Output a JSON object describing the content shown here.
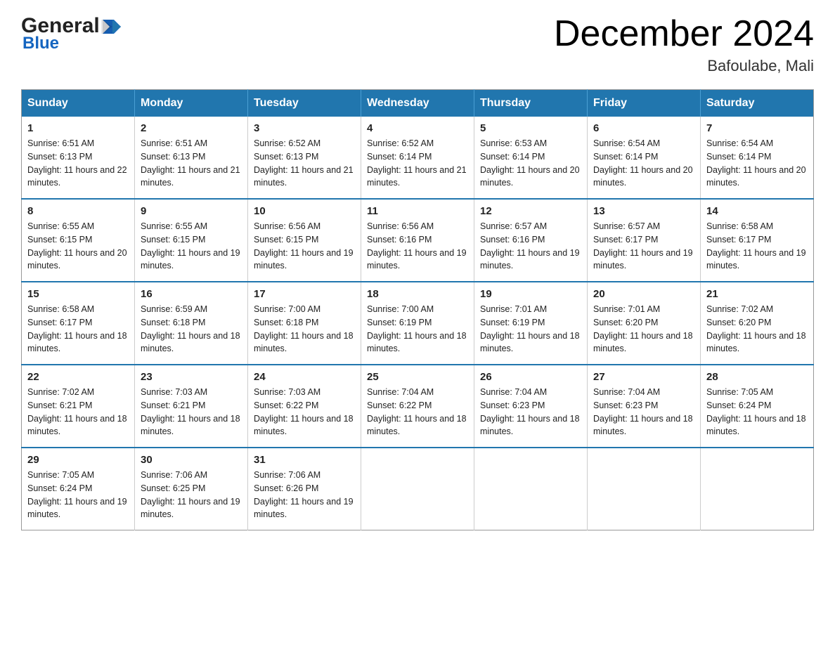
{
  "header": {
    "logo_general": "General",
    "logo_blue": "Blue",
    "title": "December 2024",
    "subtitle": "Bafoulabe, Mali"
  },
  "days_of_week": [
    "Sunday",
    "Monday",
    "Tuesday",
    "Wednesday",
    "Thursday",
    "Friday",
    "Saturday"
  ],
  "weeks": [
    [
      {
        "day": "1",
        "sunrise": "6:51 AM",
        "sunset": "6:13 PM",
        "daylight": "11 hours and 22 minutes."
      },
      {
        "day": "2",
        "sunrise": "6:51 AM",
        "sunset": "6:13 PM",
        "daylight": "11 hours and 21 minutes."
      },
      {
        "day": "3",
        "sunrise": "6:52 AM",
        "sunset": "6:13 PM",
        "daylight": "11 hours and 21 minutes."
      },
      {
        "day": "4",
        "sunrise": "6:52 AM",
        "sunset": "6:14 PM",
        "daylight": "11 hours and 21 minutes."
      },
      {
        "day": "5",
        "sunrise": "6:53 AM",
        "sunset": "6:14 PM",
        "daylight": "11 hours and 20 minutes."
      },
      {
        "day": "6",
        "sunrise": "6:54 AM",
        "sunset": "6:14 PM",
        "daylight": "11 hours and 20 minutes."
      },
      {
        "day": "7",
        "sunrise": "6:54 AM",
        "sunset": "6:14 PM",
        "daylight": "11 hours and 20 minutes."
      }
    ],
    [
      {
        "day": "8",
        "sunrise": "6:55 AM",
        "sunset": "6:15 PM",
        "daylight": "11 hours and 20 minutes."
      },
      {
        "day": "9",
        "sunrise": "6:55 AM",
        "sunset": "6:15 PM",
        "daylight": "11 hours and 19 minutes."
      },
      {
        "day": "10",
        "sunrise": "6:56 AM",
        "sunset": "6:15 PM",
        "daylight": "11 hours and 19 minutes."
      },
      {
        "day": "11",
        "sunrise": "6:56 AM",
        "sunset": "6:16 PM",
        "daylight": "11 hours and 19 minutes."
      },
      {
        "day": "12",
        "sunrise": "6:57 AM",
        "sunset": "6:16 PM",
        "daylight": "11 hours and 19 minutes."
      },
      {
        "day": "13",
        "sunrise": "6:57 AM",
        "sunset": "6:17 PM",
        "daylight": "11 hours and 19 minutes."
      },
      {
        "day": "14",
        "sunrise": "6:58 AM",
        "sunset": "6:17 PM",
        "daylight": "11 hours and 19 minutes."
      }
    ],
    [
      {
        "day": "15",
        "sunrise": "6:58 AM",
        "sunset": "6:17 PM",
        "daylight": "11 hours and 18 minutes."
      },
      {
        "day": "16",
        "sunrise": "6:59 AM",
        "sunset": "6:18 PM",
        "daylight": "11 hours and 18 minutes."
      },
      {
        "day": "17",
        "sunrise": "7:00 AM",
        "sunset": "6:18 PM",
        "daylight": "11 hours and 18 minutes."
      },
      {
        "day": "18",
        "sunrise": "7:00 AM",
        "sunset": "6:19 PM",
        "daylight": "11 hours and 18 minutes."
      },
      {
        "day": "19",
        "sunrise": "7:01 AM",
        "sunset": "6:19 PM",
        "daylight": "11 hours and 18 minutes."
      },
      {
        "day": "20",
        "sunrise": "7:01 AM",
        "sunset": "6:20 PM",
        "daylight": "11 hours and 18 minutes."
      },
      {
        "day": "21",
        "sunrise": "7:02 AM",
        "sunset": "6:20 PM",
        "daylight": "11 hours and 18 minutes."
      }
    ],
    [
      {
        "day": "22",
        "sunrise": "7:02 AM",
        "sunset": "6:21 PM",
        "daylight": "11 hours and 18 minutes."
      },
      {
        "day": "23",
        "sunrise": "7:03 AM",
        "sunset": "6:21 PM",
        "daylight": "11 hours and 18 minutes."
      },
      {
        "day": "24",
        "sunrise": "7:03 AM",
        "sunset": "6:22 PM",
        "daylight": "11 hours and 18 minutes."
      },
      {
        "day": "25",
        "sunrise": "7:04 AM",
        "sunset": "6:22 PM",
        "daylight": "11 hours and 18 minutes."
      },
      {
        "day": "26",
        "sunrise": "7:04 AM",
        "sunset": "6:23 PM",
        "daylight": "11 hours and 18 minutes."
      },
      {
        "day": "27",
        "sunrise": "7:04 AM",
        "sunset": "6:23 PM",
        "daylight": "11 hours and 18 minutes."
      },
      {
        "day": "28",
        "sunrise": "7:05 AM",
        "sunset": "6:24 PM",
        "daylight": "11 hours and 18 minutes."
      }
    ],
    [
      {
        "day": "29",
        "sunrise": "7:05 AM",
        "sunset": "6:24 PM",
        "daylight": "11 hours and 19 minutes."
      },
      {
        "day": "30",
        "sunrise": "7:06 AM",
        "sunset": "6:25 PM",
        "daylight": "11 hours and 19 minutes."
      },
      {
        "day": "31",
        "sunrise": "7:06 AM",
        "sunset": "6:26 PM",
        "daylight": "11 hours and 19 minutes."
      },
      null,
      null,
      null,
      null
    ]
  ],
  "labels": {
    "sunrise": "Sunrise:",
    "sunset": "Sunset:",
    "daylight": "Daylight:"
  }
}
